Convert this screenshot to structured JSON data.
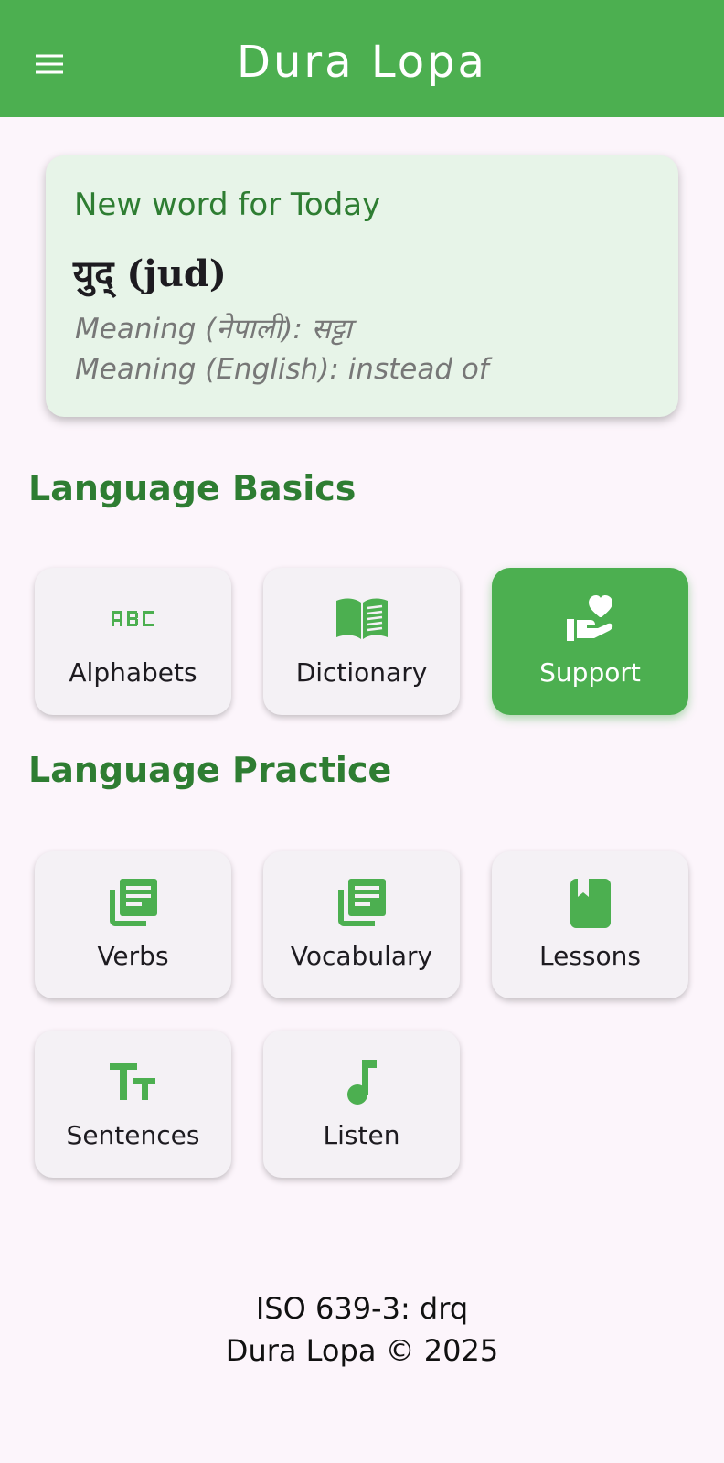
{
  "app_bar": {
    "title": "Dura Lopa",
    "menu_icon": "menu-icon",
    "color": "#4caf50"
  },
  "word_of_day": {
    "heading": "New word for Today",
    "word": "युद् (jud)",
    "meaning_nepali": "Meaning (नेपाली): सट्टा",
    "meaning_english": "Meaning (English): instead of"
  },
  "sections": {
    "basics": {
      "title": "Language Basics",
      "tiles": [
        {
          "label": "Alphabets",
          "icon": "abc-icon"
        },
        {
          "label": "Dictionary",
          "icon": "book-icon"
        },
        {
          "label": "Support",
          "icon": "volunteer-heart-icon",
          "highlighted": true
        }
      ]
    },
    "practice": {
      "title": "Language Practice",
      "tiles": [
        {
          "label": "Verbs",
          "icon": "library-books-icon"
        },
        {
          "label": "Vocabulary",
          "icon": "library-books-icon"
        },
        {
          "label": "Lessons",
          "icon": "bookmark-book-icon"
        },
        {
          "label": "Sentences",
          "icon": "text-fields-icon"
        },
        {
          "label": "Listen",
          "icon": "music-note-icon"
        }
      ]
    }
  },
  "footer": {
    "iso_code": "ISO 639-3: drq",
    "copyright": "Dura Lopa © 2025"
  },
  "colors": {
    "accent": "#4caf50",
    "heading_green": "#2e7d32",
    "card_bg": "#e7f4e8",
    "tile_bg": "#f4f1f5",
    "page_bg": "#fcf5fb"
  }
}
